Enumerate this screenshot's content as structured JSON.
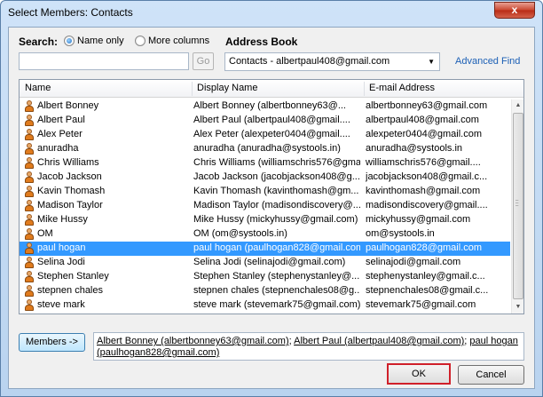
{
  "window": {
    "title": "Select Members: Contacts",
    "close_glyph": "x"
  },
  "search": {
    "label": "Search:",
    "options": [
      {
        "label": "Name only",
        "selected": true
      },
      {
        "label": "More columns",
        "selected": false
      }
    ],
    "input_value": "",
    "go_label": "Go"
  },
  "address_book": {
    "label": "Address Book",
    "selected": "Contacts - albertpaul408@gmail.com",
    "advanced_find": "Advanced Find"
  },
  "table": {
    "columns": [
      "Name",
      "Display Name",
      "E-mail Address"
    ],
    "rows": [
      {
        "name": "Albert Bonney",
        "display": "Albert Bonney (albertbonney63@...",
        "email": "albertbonney63@gmail.com",
        "selected": false
      },
      {
        "name": "Albert Paul",
        "display": "Albert Paul (albertpaul408@gmail....",
        "email": "albertpaul408@gmail.com",
        "selected": false
      },
      {
        "name": "Alex Peter",
        "display": "Alex Peter (alexpeter0404@gmail....",
        "email": "alexpeter0404@gmail.com",
        "selected": false
      },
      {
        "name": "anuradha",
        "display": "anuradha (anuradha@systools.in)",
        "email": "anuradha@systools.in",
        "selected": false
      },
      {
        "name": "Chris Williams",
        "display": "Chris Williams (williamschris576@gmai...",
        "email": "williamschris576@gmail....",
        "selected": false
      },
      {
        "name": "Jacob Jackson",
        "display": "Jacob Jackson (jacobjackson408@g...",
        "email": "jacobjackson408@gmail.c...",
        "selected": false
      },
      {
        "name": "Kavin Thomash",
        "display": "Kavin Thomash (kavinthomash@gm...",
        "email": "kavinthomash@gmail.com",
        "selected": false
      },
      {
        "name": "Madison Taylor",
        "display": "Madison Taylor (madisondiscovery@...",
        "email": "madisondiscovery@gmail....",
        "selected": false
      },
      {
        "name": "Mike Hussy",
        "display": "Mike Hussy (mickyhussy@gmail.com)",
        "email": "mickyhussy@gmail.com",
        "selected": false
      },
      {
        "name": "OM",
        "display": "OM (om@systools.in)",
        "email": "om@systools.in",
        "selected": false
      },
      {
        "name": "paul hogan",
        "display": "paul hogan (paulhogan828@gmail.com)",
        "email": "paulhogan828@gmail.com",
        "selected": true
      },
      {
        "name": "Selina Jodi",
        "display": "Selina Jodi (selinajodi@gmail.com)",
        "email": "selinajodi@gmail.com",
        "selected": false
      },
      {
        "name": "Stephen Stanley",
        "display": "Stephen Stanley (stephenystanley@...",
        "email": "stephenystanley@gmail.c...",
        "selected": false
      },
      {
        "name": "stepnen chales",
        "display": "stepnen chales (stepnenchales08@g...",
        "email": "stepnenchales08@gmail.c...",
        "selected": false
      },
      {
        "name": "steve mark",
        "display": "steve mark (stevemark75@gmail.com)",
        "email": "stevemark75@gmail.com",
        "selected": false
      }
    ]
  },
  "members": {
    "button_label": "Members ->",
    "entries": [
      "Albert Bonney (albertbonney63@gmail.com)",
      "Albert Paul (albertpaul408@gmail.com)",
      "paul hogan (paulhogan828@gmail.com)"
    ],
    "separator": ";"
  },
  "buttons": {
    "ok": "OK",
    "cancel": "Cancel"
  },
  "colors": {
    "selection": "#3399ff",
    "link": "#1b5fb5",
    "ok_highlight": "#d0202a"
  }
}
